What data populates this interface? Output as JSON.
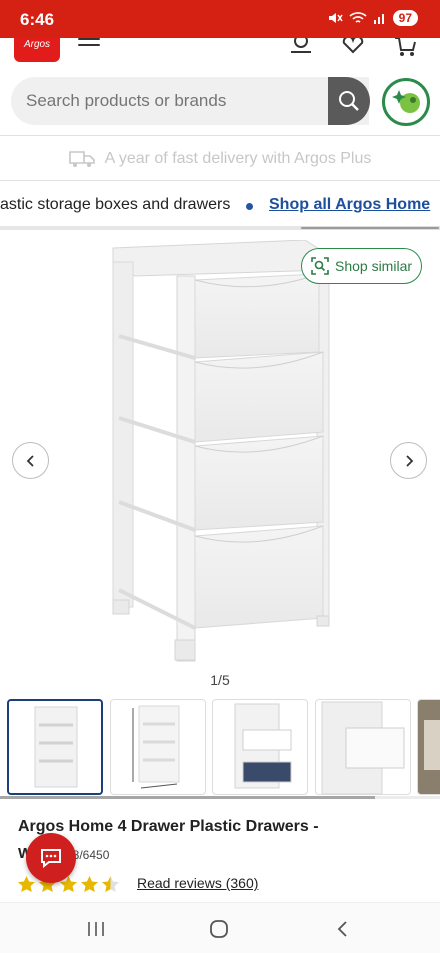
{
  "status_bar": {
    "time": "6:46",
    "battery": "97",
    "bg_color": "#d42114"
  },
  "header": {
    "logo_text": "Argos",
    "icons": [
      "menu-icon",
      "account-icon",
      "wishlist-heart-icon",
      "trolley-icon"
    ]
  },
  "search": {
    "placeholder": "Search products or brands",
    "button_icon": "search-icon",
    "assistant_icon": "assistant-sparkle-icon"
  },
  "promo": {
    "text": "A year of fast delivery with Argos Plus",
    "icon": "delivery-van-icon"
  },
  "breadcrumbs": {
    "text": "astic storage boxes and drawers",
    "link_label": "Shop all Argos Home"
  },
  "gallery": {
    "shop_similar_label": "Shop similar",
    "counter": "1/5",
    "current_image": 1,
    "total_images": 5,
    "thumbnails": [
      {
        "name": "thumb-front-view",
        "active": true
      },
      {
        "name": "thumb-dimensions-view",
        "active": false
      },
      {
        "name": "thumb-open-drawers",
        "active": false
      },
      {
        "name": "thumb-drawer-detail",
        "active": false
      },
      {
        "name": "thumb-lifestyle",
        "active": false
      }
    ]
  },
  "product": {
    "title": "Argos Home 4 Drawer Plastic Drawers -",
    "title_line2": "W",
    "sku": "48/6450",
    "rating": 4.5,
    "rating_max": 5,
    "reviews_label": "Read reviews (360)"
  },
  "colors": {
    "brand_red": "#d42114",
    "link_blue": "#1d4f9c",
    "accent_green": "#2c8a4a",
    "star_gold": "#e8b800"
  }
}
